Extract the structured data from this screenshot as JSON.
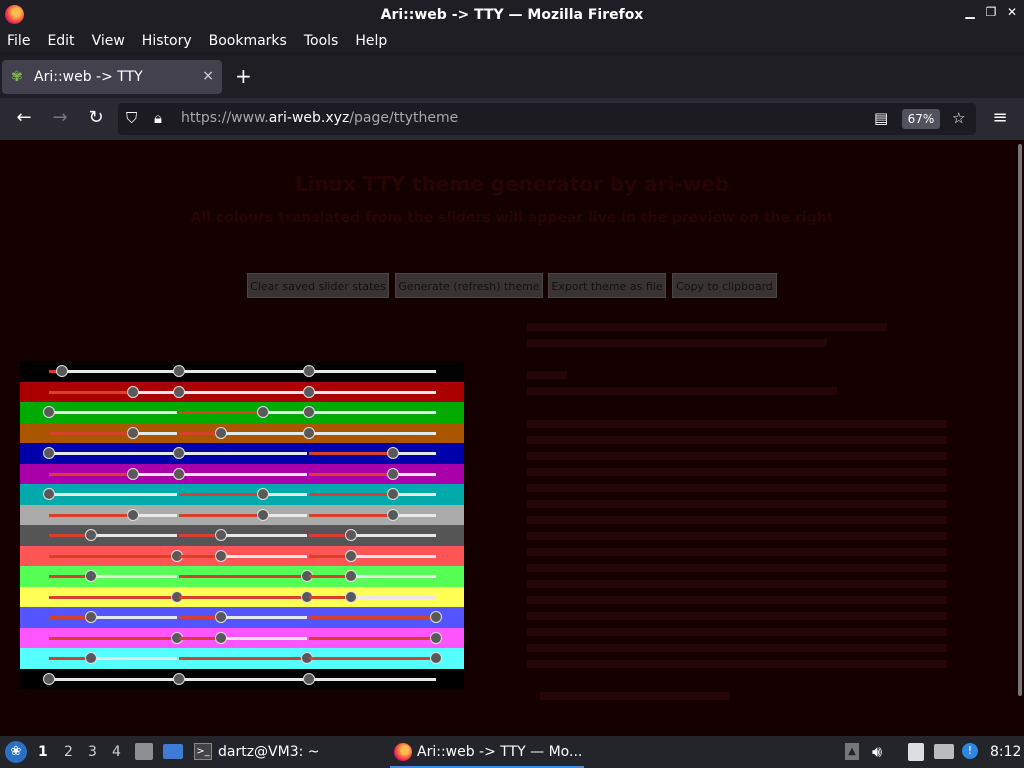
{
  "window": {
    "title": "Ari::web -> TTY — Mozilla Firefox"
  },
  "menu": [
    "File",
    "Edit",
    "View",
    "History",
    "Bookmarks",
    "Tools",
    "Help"
  ],
  "tab": {
    "label": "Ari::web -> TTY",
    "close": "×",
    "new": "+"
  },
  "nav": {
    "url_prefix": "https://www.",
    "url_host": "ari-web.xyz",
    "url_path": "/page/ttytheme",
    "zoom": "67%"
  },
  "page": {
    "heading": "Linux TTY theme generator by ari-web",
    "subheading": "All colours translated from the sliders will appear live in the preview on the right",
    "buttons": [
      "Clear saved slider states",
      "Generate (refresh) theme",
      "Export theme as file",
      "Copy to clipboard"
    ],
    "rows": [
      {
        "bg": "#000000",
        "levels": [
          0.1,
          0.0,
          0.0
        ]
      },
      {
        "bg": "#aa0000",
        "levels": [
          0.66,
          0.0,
          0.0
        ]
      },
      {
        "bg": "#00aa00",
        "levels": [
          0.0,
          0.66,
          0.0
        ]
      },
      {
        "bg": "#aa5500",
        "levels": [
          0.66,
          0.33,
          0.0
        ]
      },
      {
        "bg": "#0000aa",
        "levels": [
          0.0,
          0.0,
          0.66
        ]
      },
      {
        "bg": "#aa00aa",
        "levels": [
          0.66,
          0.0,
          0.66
        ]
      },
      {
        "bg": "#00aaaa",
        "levels": [
          0.0,
          0.66,
          0.66
        ]
      },
      {
        "bg": "#aaaaaa",
        "levels": [
          0.66,
          0.66,
          0.66
        ]
      },
      {
        "bg": "#555555",
        "levels": [
          0.33,
          0.33,
          0.33
        ]
      },
      {
        "bg": "#ff5555",
        "levels": [
          1.0,
          0.33,
          0.33
        ]
      },
      {
        "bg": "#55ff55",
        "levels": [
          0.33,
          1.0,
          0.33
        ]
      },
      {
        "bg": "#ffff55",
        "levels": [
          1.0,
          1.0,
          0.33
        ]
      },
      {
        "bg": "#5555ff",
        "levels": [
          0.33,
          0.33,
          1.0
        ]
      },
      {
        "bg": "#ff55ff",
        "levels": [
          1.0,
          0.33,
          1.0
        ]
      },
      {
        "bg": "#55ffff",
        "levels": [
          0.33,
          1.0,
          1.0
        ]
      },
      {
        "bg": "#000000",
        "levels": [
          0.0,
          0.0,
          0.0
        ]
      }
    ]
  },
  "taskbar": {
    "workspaces": [
      "1",
      "2",
      "3",
      "4"
    ],
    "terminal": "dartz@VM3: ~",
    "firefox": "Ari::web -> TTY — Mo...",
    "clock": "8:12"
  }
}
